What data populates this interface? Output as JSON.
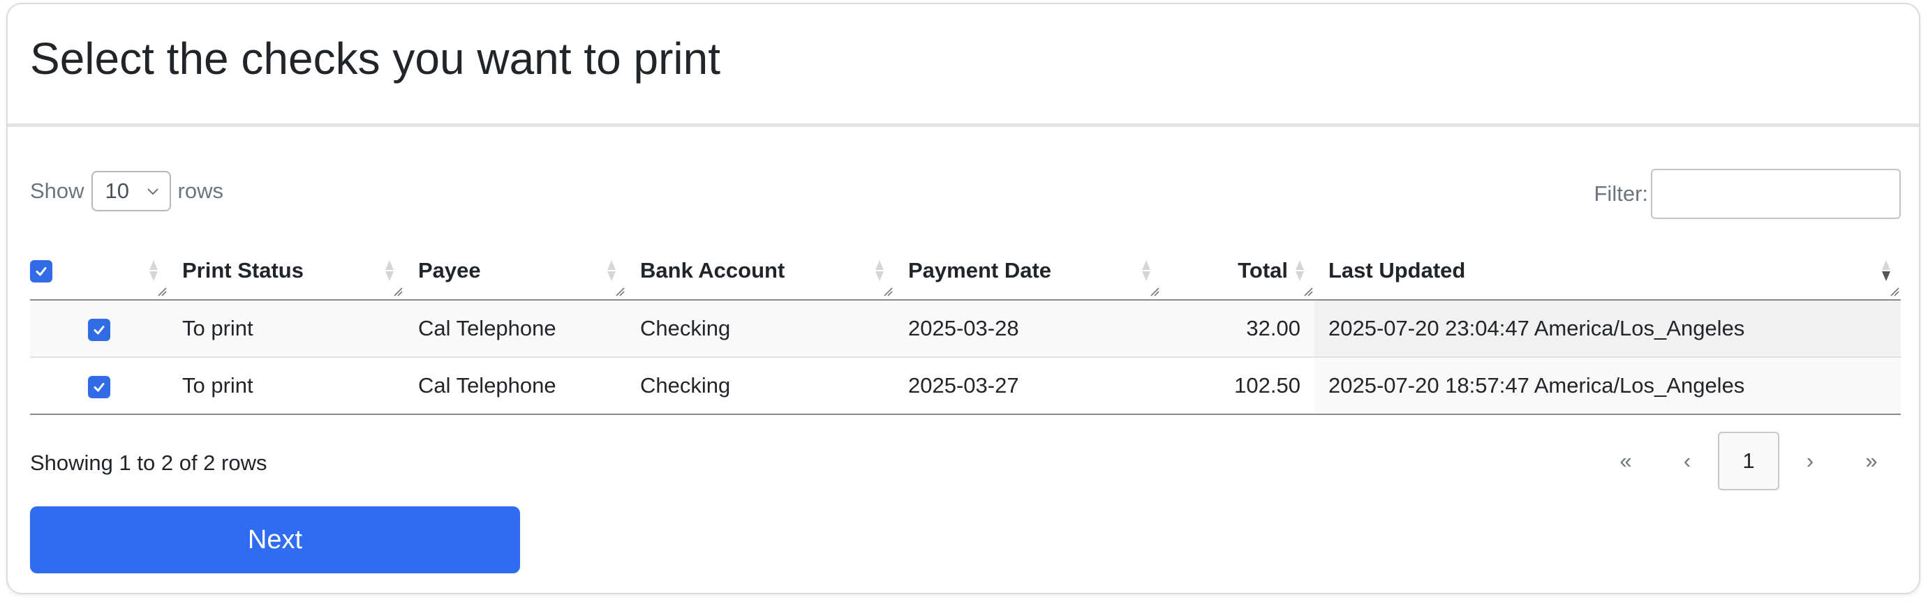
{
  "header": {
    "title": "Select the checks you want to print"
  },
  "controls": {
    "show_label": "Show",
    "rows_per_page": "10",
    "rows_label": "rows",
    "filter_label": "Filter:",
    "filter_value": ""
  },
  "table": {
    "columns": [
      {
        "label": ""
      },
      {
        "label": "Print Status"
      },
      {
        "label": "Payee"
      },
      {
        "label": "Bank Account"
      },
      {
        "label": "Payment Date"
      },
      {
        "label": "Total"
      },
      {
        "label": "Last Updated"
      }
    ],
    "rows": [
      {
        "checked": true,
        "print_status": "To print",
        "payee": "Cal Telephone",
        "bank_account": "Checking",
        "payment_date": "2025-03-28",
        "total": "32.00",
        "last_updated": "2025-07-20 23:04:47 America/Los_Angeles"
      },
      {
        "checked": true,
        "print_status": "To print",
        "payee": "Cal Telephone",
        "bank_account": "Checking",
        "payment_date": "2025-03-27",
        "total": "102.50",
        "last_updated": "2025-07-20 18:57:47 America/Los_Angeles"
      }
    ]
  },
  "footer": {
    "info": "Showing 1 to 2 of 2 rows",
    "pager": {
      "first": "«",
      "prev": "‹",
      "current": "1",
      "next": "›",
      "last": "»"
    }
  },
  "actions": {
    "next_label": "Next"
  },
  "colors": {
    "accent": "#306cf0",
    "checkbox": "#2f6ce5"
  },
  "icons": {
    "sort": "sort-both-icon",
    "sort_desc": "sort-desc-icon",
    "resize": "column-resize-icon",
    "check": "checkmark-icon",
    "dropdown": "chevron-down-icon"
  }
}
